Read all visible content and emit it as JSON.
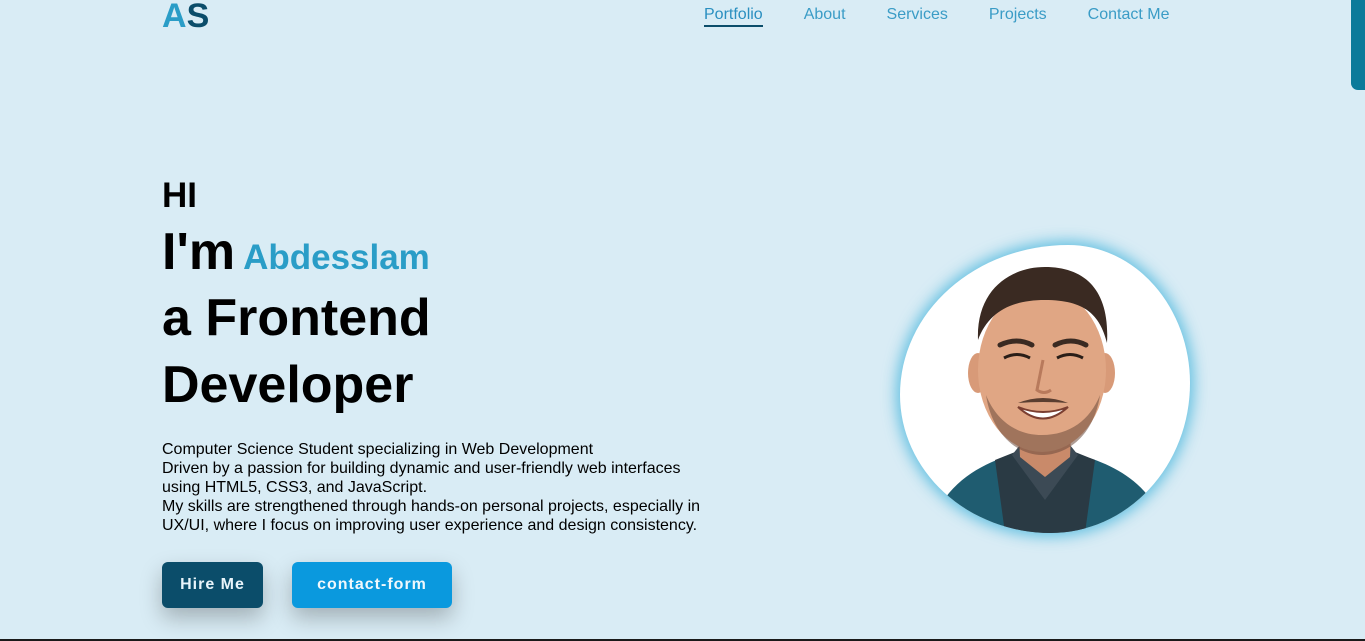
{
  "header": {
    "logo_part1": "A",
    "logo_part2": "S",
    "nav": [
      {
        "label": "Portfolio",
        "active": true
      },
      {
        "label": "About",
        "active": false
      },
      {
        "label": "Services",
        "active": false
      },
      {
        "label": "Projects",
        "active": false
      },
      {
        "label": "Contact Me",
        "active": false
      }
    ]
  },
  "hero": {
    "greeting": "HI",
    "im": "I'm",
    "name": "Abdesslam",
    "role_line1": "a Frontend",
    "role_line2": "Developer",
    "bio": [
      "Computer Science Student specializing in Web Development",
      "Driven by a passion for building dynamic and user-friendly web interfaces",
      "using HTML5, CSS3, and JavaScript.",
      "My skills are strengthened through hands-on personal projects, especially in",
      "UX/UI, where I focus on improving user experience and design consistency."
    ],
    "hire_button": "Hire Me",
    "contact_button": "contact-form"
  },
  "colors": {
    "background": "#d9ecf5",
    "accent": "#2a9dc7",
    "dark_accent": "#0b4d6a",
    "button_blue": "#0a99de"
  }
}
